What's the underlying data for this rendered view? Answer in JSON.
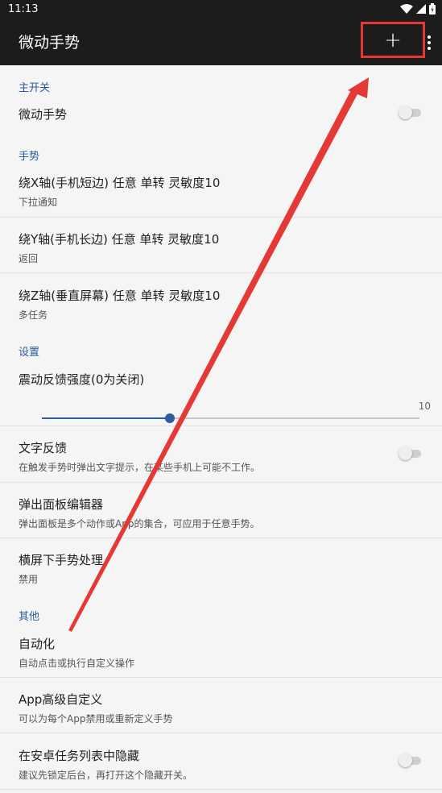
{
  "status": {
    "time": "11:13"
  },
  "app_bar": {
    "title": "微动手势",
    "add_label": "+"
  },
  "sections": {
    "main": "主开关",
    "gestures": "手势",
    "settings": "设置",
    "other": "其他"
  },
  "main_switch": {
    "title": "微动手势",
    "enabled": false
  },
  "gestures": [
    {
      "title": "绕X轴(手机短边) 任意 单转 灵敏度10",
      "summary": "下拉通知"
    },
    {
      "title": "绕Y轴(手机长边) 任意 单转 灵敏度10",
      "summary": "返回"
    },
    {
      "title": "绕Z轴(垂直屏幕) 任意 单转 灵敏度10",
      "summary": "多任务"
    }
  ],
  "vibration": {
    "title": "震动反馈强度(0为关闭)",
    "value": 3.4,
    "max": 10,
    "max_label": "10"
  },
  "text_feedback": {
    "title": "文字反馈",
    "summary": "在触发手势时弹出文字提示，在某些手机上可能不工作。",
    "enabled": false
  },
  "popup_editor": {
    "title": "弹出面板编辑器",
    "summary": "弹出面板是多个动作或App的集合，可应用于任意手势。"
  },
  "landscape": {
    "title": "横屏下手势处理",
    "summary": "禁用"
  },
  "automation": {
    "title": "自动化",
    "summary": "自动点击或执行自定义操作"
  },
  "app_custom": {
    "title": "App高级自定义",
    "summary": "可以为每个App禁用或重新定义手势"
  },
  "hide_recents": {
    "title": "在安卓任务列表中隐藏",
    "summary": "建议先锁定后台，再打开这个隐藏开关。",
    "enabled": false
  },
  "colors": {
    "accent": "#2e5d9e",
    "highlight": "#e53935",
    "bar": "#1c1c1c"
  }
}
